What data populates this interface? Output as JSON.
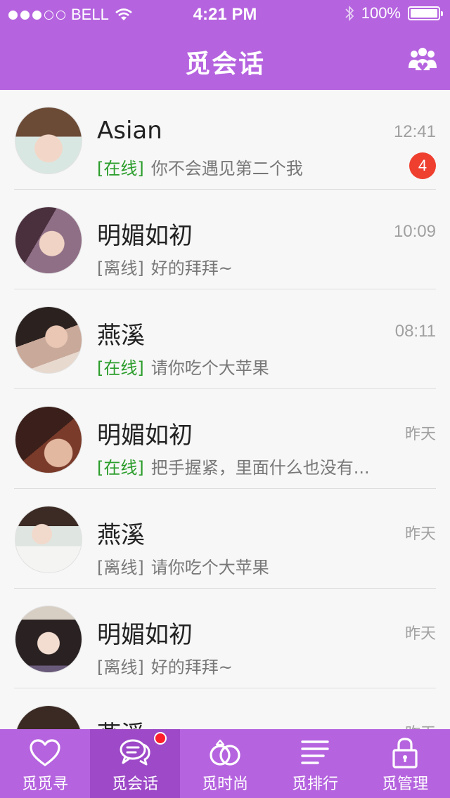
{
  "status_bar": {
    "carrier": "BELL",
    "time": "4:21 PM",
    "battery": "100%"
  },
  "header": {
    "title": "觅会话",
    "contacts_icon": "group-icon"
  },
  "conversations": [
    {
      "name": "Asian",
      "status": "[在线]",
      "online": true,
      "message": "你不会遇见第二个我",
      "time": "12:41",
      "unread": "4"
    },
    {
      "name": "明媚如初",
      "status": "[离线]",
      "online": false,
      "message": "好的拜拜~",
      "time": "10:09",
      "unread": ""
    },
    {
      "name": "燕溪",
      "status": "[在线]",
      "online": true,
      "message": "请你吃个大苹果",
      "time": "08:11",
      "unread": ""
    },
    {
      "name": "明媚如初",
      "status": "[在线]",
      "online": true,
      "message": "把手握紧，里面什么也没有...",
      "time": "昨天",
      "unread": ""
    },
    {
      "name": "燕溪",
      "status": "[离线]",
      "online": false,
      "message": "请你吃个大苹果",
      "time": "昨天",
      "unread": ""
    },
    {
      "name": "明媚如初",
      "status": "[离线]",
      "online": false,
      "message": "好的拜拜~",
      "time": "昨天",
      "unread": ""
    },
    {
      "name": "燕溪",
      "status": "",
      "online": false,
      "message": "",
      "time": "昨天",
      "unread": ""
    }
  ],
  "tabs": [
    {
      "label": "觅觅寻",
      "icon": "heart-icon"
    },
    {
      "label": "觅会话",
      "icon": "chat-bubbles-icon",
      "active": true,
      "has_dot": true
    },
    {
      "label": "觅时尚",
      "icon": "rings-icon"
    },
    {
      "label": "觅排行",
      "icon": "list-lines-icon"
    },
    {
      "label": "觅管理",
      "icon": "lock-icon"
    }
  ],
  "colors": {
    "accent": "#b563df",
    "active_tab": "#9d49c8",
    "online_status": "#2a9d2a",
    "badge": "#ef3f2f"
  }
}
